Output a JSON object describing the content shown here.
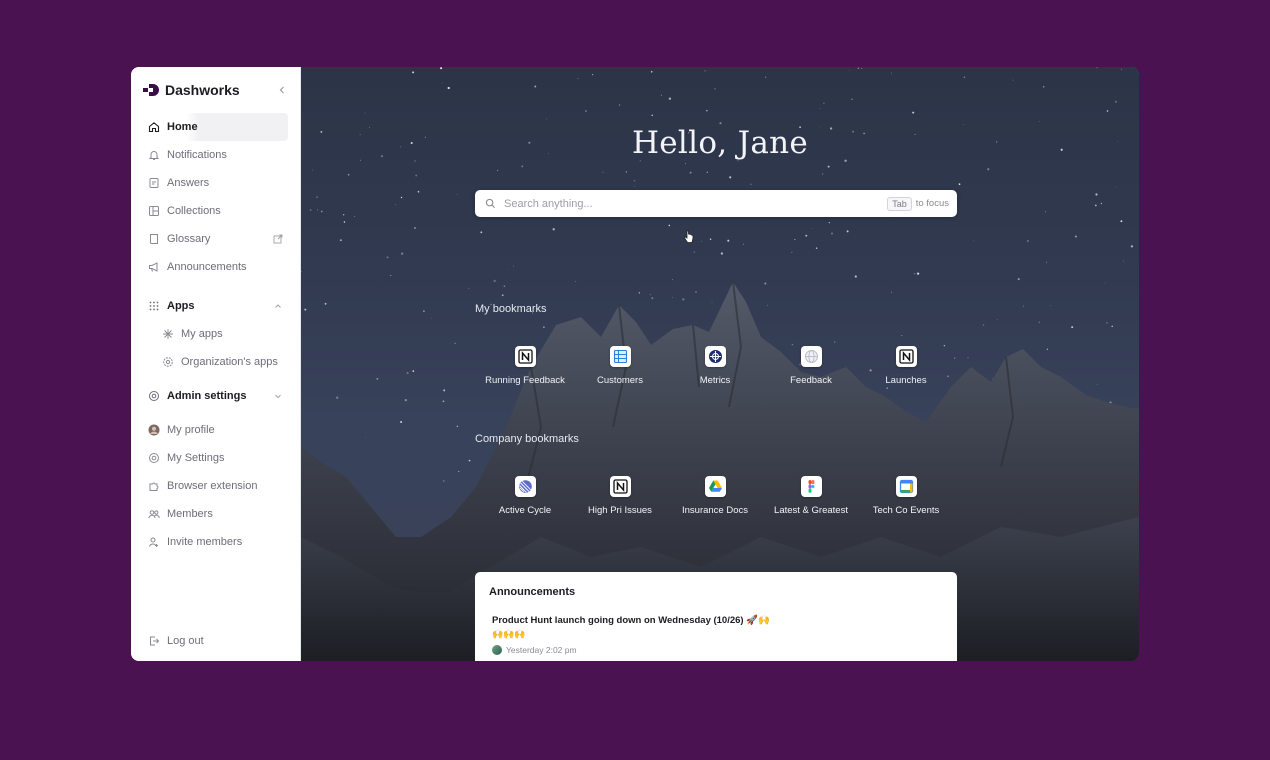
{
  "sidebar": {
    "brand": "Dashworks",
    "nav": [
      {
        "label": "Home",
        "icon": "home-icon"
      },
      {
        "label": "Notifications",
        "icon": "bell-icon"
      },
      {
        "label": "Answers",
        "icon": "answers-icon"
      },
      {
        "label": "Collections",
        "icon": "collections-icon"
      },
      {
        "label": "Glossary",
        "icon": "book-icon",
        "trail_icon": "external-link-icon"
      },
      {
        "label": "Announcements",
        "icon": "megaphone-icon"
      }
    ],
    "apps": {
      "label": "Apps",
      "icon": "grid-icon",
      "items": [
        {
          "label": "My apps",
          "icon": "sparkle-icon"
        },
        {
          "label": "Organization's apps",
          "icon": "gear-icon"
        }
      ]
    },
    "admin_settings": {
      "label": "Admin settings",
      "icon": "settings-icon"
    },
    "account": [
      {
        "label": "My profile",
        "icon": "avatar"
      },
      {
        "label": "My Settings",
        "icon": "settings-icon"
      },
      {
        "label": "Browser extension",
        "icon": "puzzle-icon"
      },
      {
        "label": "Members",
        "icon": "members-icon"
      },
      {
        "label": "Invite members",
        "icon": "invite-icon"
      }
    ],
    "logout": "Log out"
  },
  "main": {
    "greeting": "Hello, Jane",
    "search": {
      "placeholder": "Search anything...",
      "shortcut_key": "Tab",
      "shortcut_hint": "to focus"
    },
    "my_bookmarks": {
      "title": "My bookmarks",
      "items": [
        {
          "label": "Running Feedback",
          "icon": "notion-icon"
        },
        {
          "label": "Customers",
          "icon": "spreadsheet-icon"
        },
        {
          "label": "Metrics",
          "icon": "metrics-icon"
        },
        {
          "label": "Feedback",
          "icon": "globe-icon"
        },
        {
          "label": "Launches",
          "icon": "notion-icon"
        }
      ]
    },
    "company_bookmarks": {
      "title": "Company bookmarks",
      "items": [
        {
          "label": "Active Cycle",
          "icon": "linear-icon"
        },
        {
          "label": "High Pri Issues",
          "icon": "notion-icon"
        },
        {
          "label": "Insurance Docs",
          "icon": "google-drive-icon"
        },
        {
          "label": "Latest & Greatest",
          "icon": "figma-icon"
        },
        {
          "label": "Tech Co Events",
          "icon": "calendar-icon"
        }
      ]
    },
    "announcements": {
      "title": "Announcements",
      "items": [
        {
          "title": "Product Hunt launch going down on Wednesday (10/26) 🚀🙌",
          "emoji": "🙌🙌🙌",
          "time": "Yesterday 2:02 pm"
        }
      ]
    }
  },
  "colors": {
    "page_background": "#4a1250",
    "brand": "#3a0f48",
    "sidebar_background": "#ffffff",
    "text_primary": "#1c1c22",
    "text_secondary": "#6d6d78"
  }
}
